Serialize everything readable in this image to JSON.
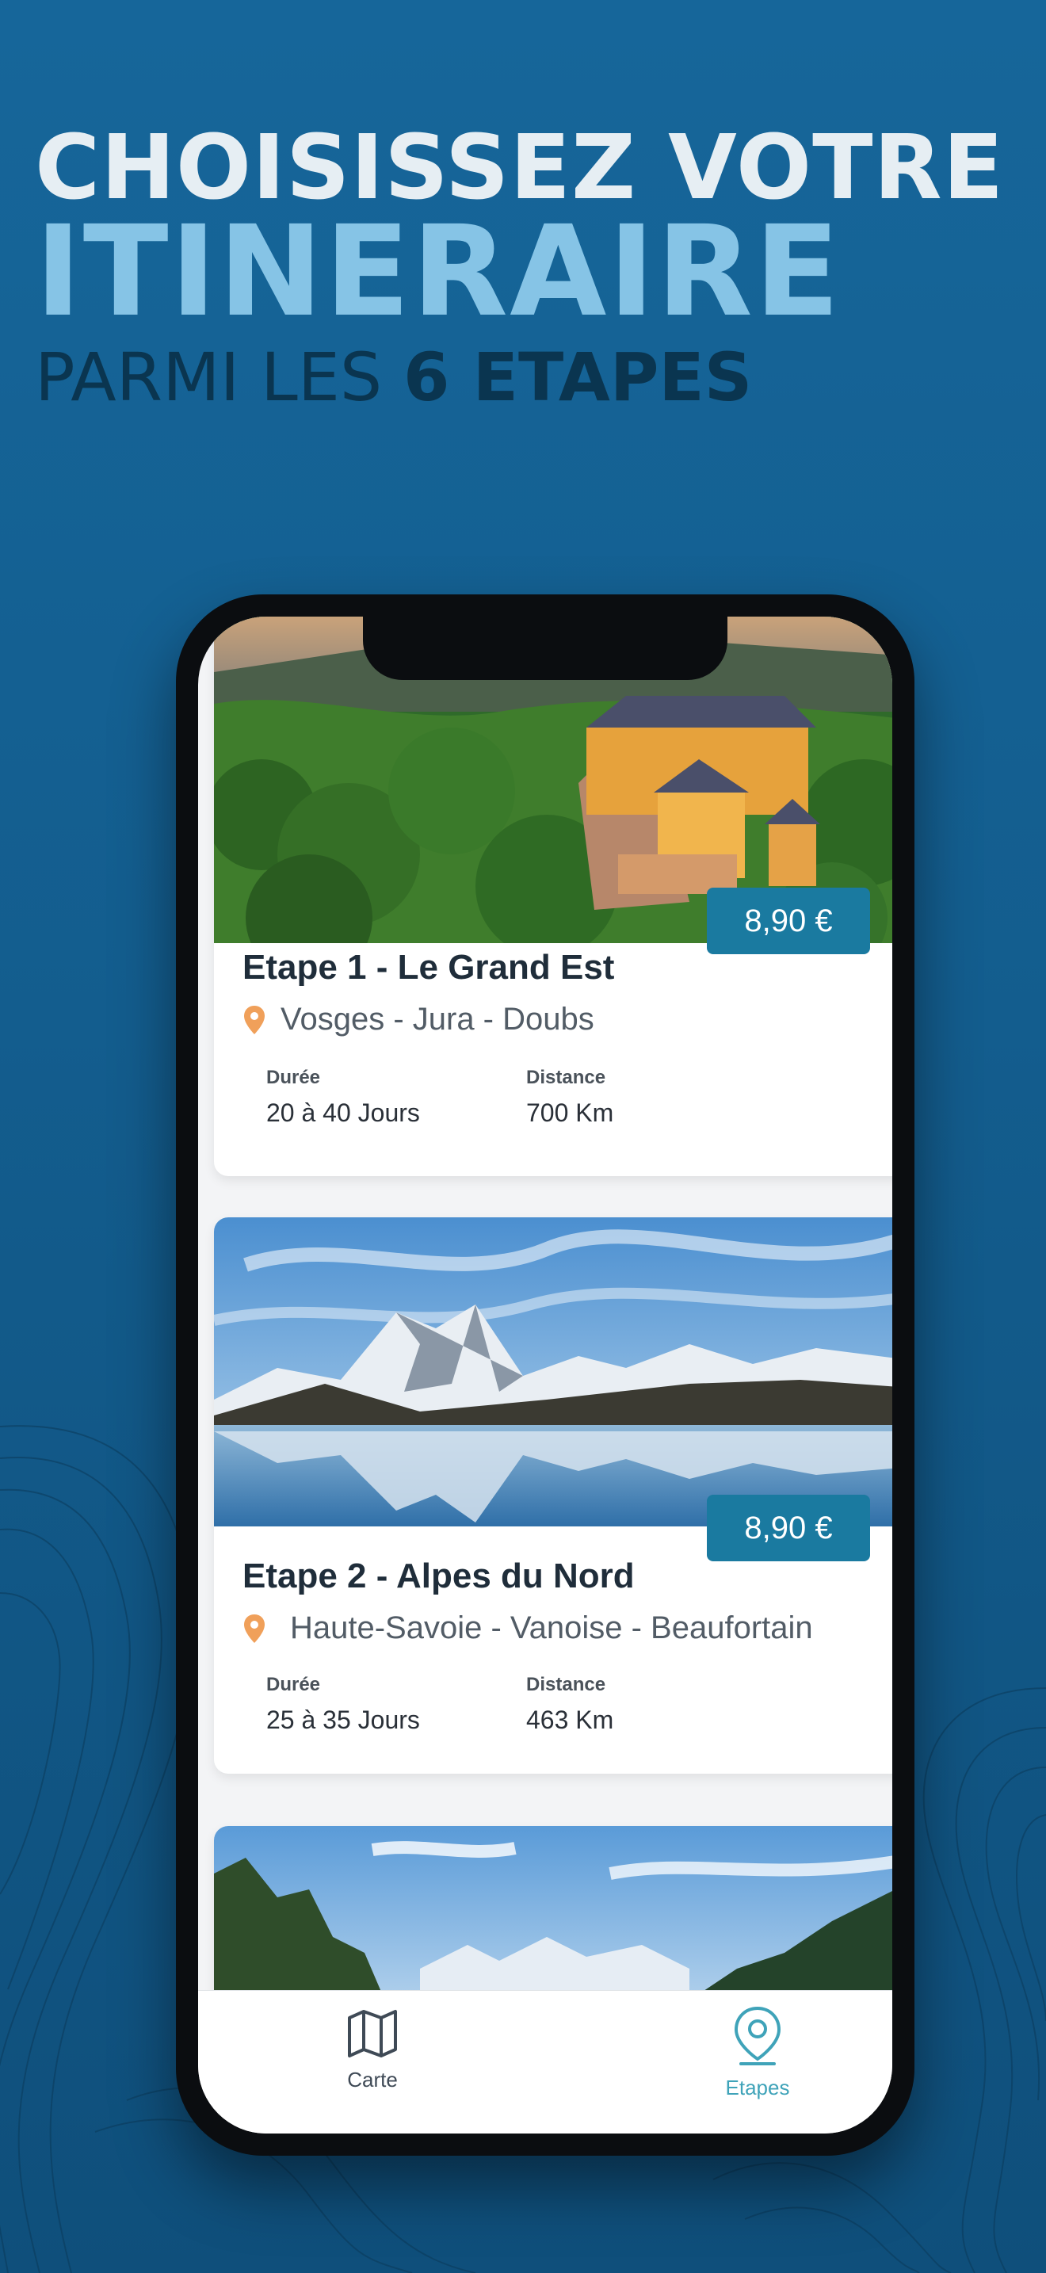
{
  "headline": {
    "line1": "CHOISISSEZ VOTRE",
    "line2": "ITINERAIRE",
    "line3_prefix": "PARMI LES",
    "line3_bold": "6 ETAPES"
  },
  "stages": [
    {
      "title": "Etape 1 - Le Grand Est",
      "region": "Vosges - Jura - Doubs",
      "price": "8,90 €",
      "duration_label": "Durée",
      "duration": "20 à 40 Jours",
      "distance_label": "Distance",
      "distance": "700 Km"
    },
    {
      "title": "Etape 2 - Alpes du Nord",
      "region": "Haute-Savoie - Vanoise - Beaufortain",
      "price": "8,90 €",
      "duration_label": "Durée",
      "duration": "25 à 35 Jours",
      "distance_label": "Distance",
      "distance": "463 Km"
    }
  ],
  "tabbar": {
    "items": [
      {
        "label": "Carte",
        "icon": "map-icon",
        "active": false
      },
      {
        "label": "Etapes",
        "icon": "location-pin-icon",
        "active": true
      }
    ]
  },
  "colors": {
    "background": "#135d8e",
    "accent_light": "#86c4e6",
    "price_badge": "#1a7aa0",
    "pin": "#f0a05a",
    "tab_active": "#3fa3b9"
  }
}
